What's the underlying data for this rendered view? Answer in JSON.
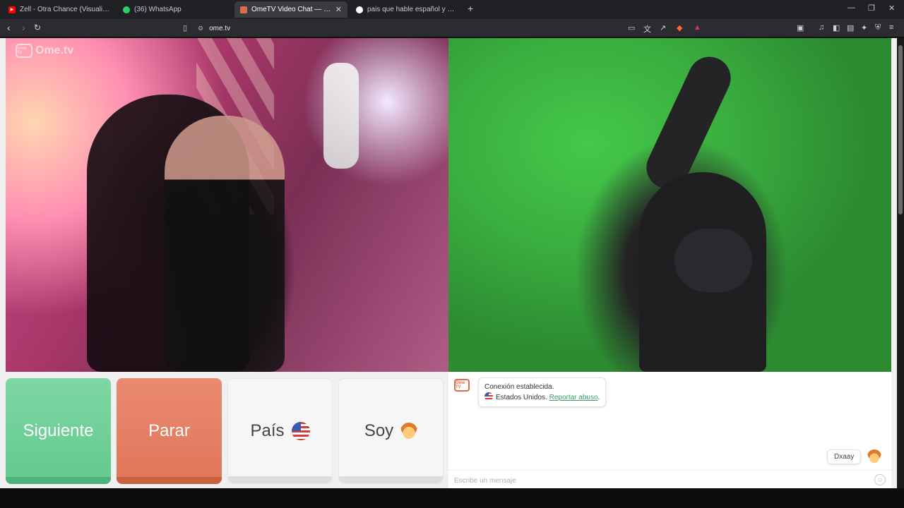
{
  "browser": {
    "tabs": [
      {
        "title": "Zell - Otra Chance (Visualizer) - YouTu",
        "favicon": "youtube-icon",
        "color": "#ff0000"
      },
      {
        "title": "(36) WhatsApp",
        "favicon": "whatsapp-icon",
        "color": "#25d366",
        "badge": "36"
      },
      {
        "title": "OmeTV Video Chat — Omegle",
        "favicon": "ometv-icon",
        "color": "#e06b4a",
        "active": true
      },
      {
        "title": "pais que hable español y sea temprano",
        "favicon": "chatgpt-icon",
        "color": "#ffffff"
      }
    ],
    "url": "ome.tv"
  },
  "page": {
    "logo": "Ome.tv",
    "logo_badge": "Ome TV",
    "buttons": {
      "next": "Siguiente",
      "stop": "Parar",
      "country": "País",
      "gender": "Soy"
    },
    "chat": {
      "status": "Conexión establecida.",
      "country": "Estados Unidos.",
      "report": "Reportar abuso",
      "peer_name": "Dxaay",
      "input_placeholder": "Escribe un mensaje"
    },
    "colors": {
      "next": "#6ccf96",
      "stop": "#e47f63",
      "link": "#3a9a6a"
    }
  }
}
